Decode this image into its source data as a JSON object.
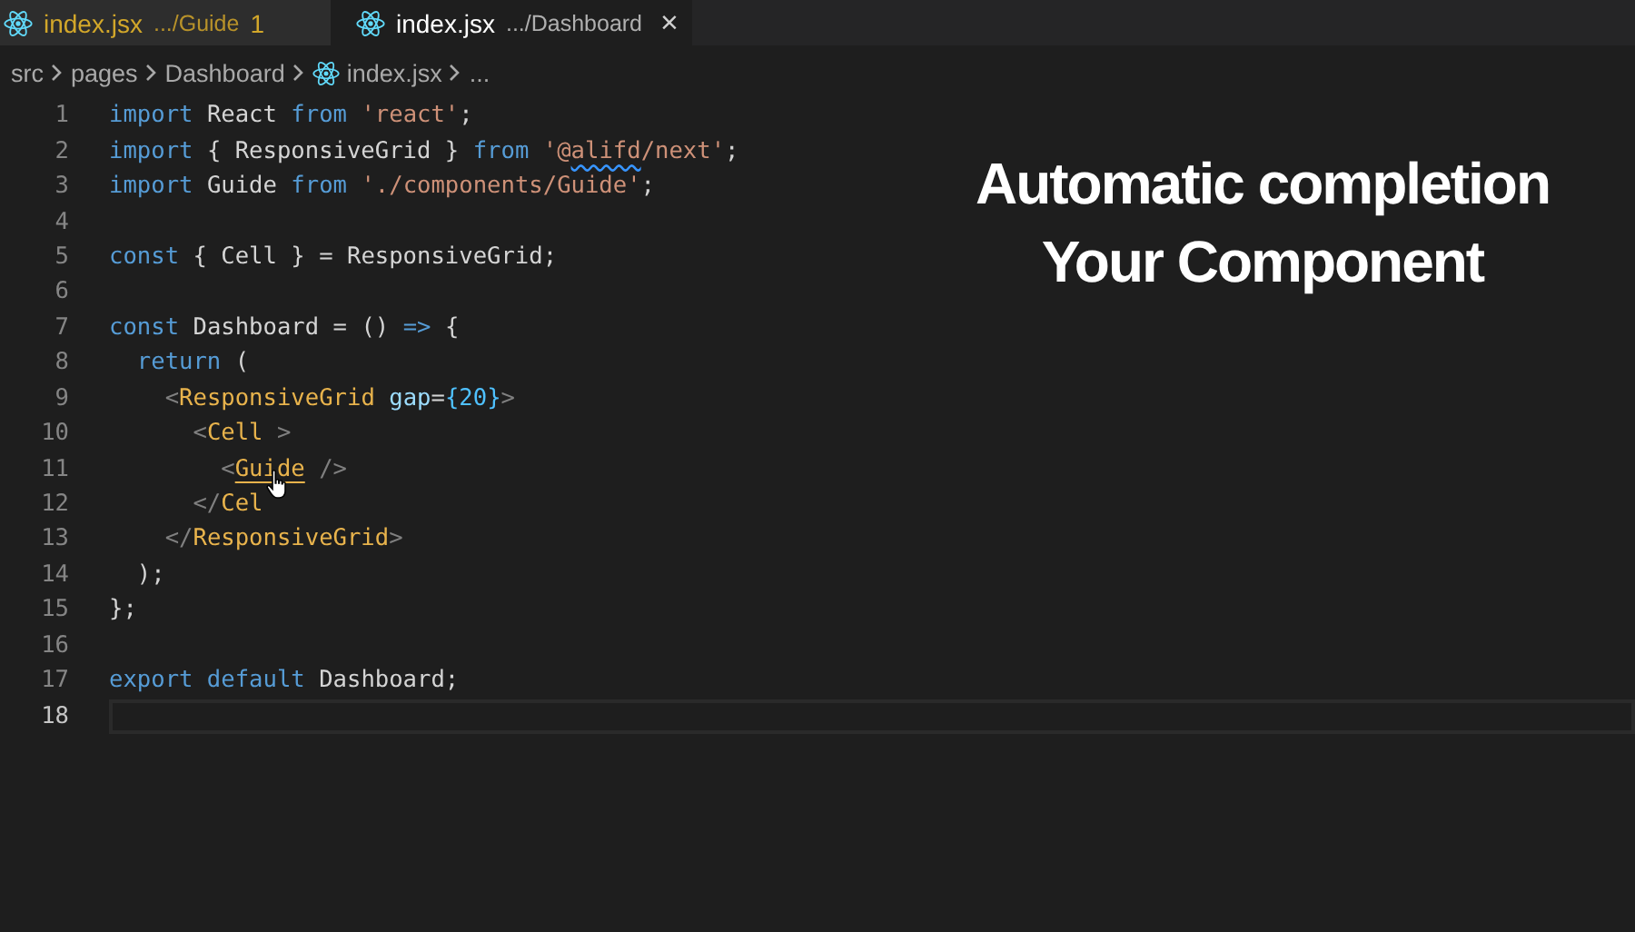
{
  "tabs": [
    {
      "name": "index.jsx",
      "path": ".../Guide",
      "badge": "1",
      "warning": true,
      "selected": false
    },
    {
      "name": "index.jsx",
      "path": ".../Dashboard",
      "close": "×",
      "warning": false,
      "selected": true
    }
  ],
  "breadcrumb": [
    {
      "label": "src",
      "kind": "folder"
    },
    {
      "label": "pages",
      "kind": "folder"
    },
    {
      "label": "Dashboard",
      "kind": "folder"
    },
    {
      "label": "index.jsx",
      "kind": "file"
    },
    {
      "label": "...",
      "kind": "more"
    }
  ],
  "lines": [
    {
      "number": "1",
      "current": false,
      "tokens": [
        {
          "t": "import",
          "kind": "kw"
        },
        {
          "t": " React ",
          "kind": "plain"
        },
        {
          "t": "from",
          "kind": "kw"
        },
        {
          "t": " 'react'",
          "kind": "str"
        },
        {
          "t": ";",
          "kind": "plain"
        }
      ]
    },
    {
      "number": "2",
      "current": false,
      "tokens": [
        {
          "t": "import",
          "kind": "kw"
        },
        {
          "t": " { ResponsiveGrid } ",
          "kind": "plain"
        },
        {
          "t": "from",
          "kind": "kw"
        },
        {
          "t": " '@",
          "kind": "str"
        },
        {
          "t": "alifd",
          "kind": "warn"
        },
        {
          "t": "/next'",
          "kind": "str"
        },
        {
          "t": ";",
          "kind": "plain"
        }
      ]
    },
    {
      "number": "3",
      "current": false,
      "tokens": [
        {
          "t": "import",
          "kind": "kw"
        },
        {
          "t": " Guide ",
          "kind": "plain"
        },
        {
          "t": "from",
          "kind": "kw"
        },
        {
          "t": " './components/Guide'",
          "kind": "str"
        },
        {
          "t": ";",
          "kind": "plain"
        }
      ]
    },
    {
      "number": "4",
      "current": false
    },
    {
      "number": "5",
      "current": false,
      "tokens": [
        {
          "t": "const",
          "kind": "kw"
        },
        {
          "t": " { Cell } = ResponsiveGrid;",
          "kind": "plain"
        }
      ]
    },
    {
      "number": "6",
      "current": false
    },
    {
      "number": "7",
      "current": false,
      "tokens": [
        {
          "t": "const",
          "kind": "kw"
        },
        {
          "t": " Dashboard = () ",
          "kind": "plain"
        },
        {
          "t": "=>",
          "kind": "kw"
        },
        {
          "t": " {",
          "kind": "plain"
        }
      ]
    },
    {
      "number": "8",
      "current": false,
      "tokens": [
        {
          "t": "  return",
          "kind": "kw"
        },
        {
          "t": " (",
          "kind": "plain"
        }
      ]
    },
    {
      "number": "9",
      "current": false,
      "tokens": [
        {
          "t": "    <",
          "kind": "punct"
        },
        {
          "t": "ResponsiveGrid",
          "kind": "tag"
        },
        {
          "t": " gap",
          "kind": "attr"
        },
        {
          "t": "=",
          "kind": "plain"
        },
        {
          "t": "{20}",
          "kind": "num"
        },
        {
          "t": ">",
          "kind": "punct"
        }
      ]
    },
    {
      "number": "10",
      "current": false,
      "tokens": [
        {
          "t": "      <",
          "kind": "punct"
        },
        {
          "t": "Cell",
          "kind": "tag"
        },
        {
          "t": " >",
          "kind": "punct"
        }
      ]
    },
    {
      "number": "11",
      "current": false,
      "tokens": [
        {
          "t": "        <",
          "kind": "punct"
        },
        {
          "t": "Guide",
          "kind": "link"
        },
        {
          "t": " />",
          "kind": "punct"
        }
      ]
    },
    {
      "number": "12",
      "current": false,
      "tokens": [
        {
          "t": "      </",
          "kind": "punct"
        },
        {
          "t": "Cel",
          "kind": "tag"
        }
      ]
    },
    {
      "number": "13",
      "current": false,
      "tokens": [
        {
          "t": "    </",
          "kind": "punct"
        },
        {
          "t": "ResponsiveGrid",
          "kind": "tag"
        },
        {
          "t": ">",
          "kind": "punct"
        }
      ]
    },
    {
      "number": "14",
      "current": false,
      "tokens": [
        {
          "t": "  );",
          "kind": "plain"
        }
      ]
    },
    {
      "number": "15",
      "current": false,
      "tokens": [
        {
          "t": "};",
          "kind": "plain"
        }
      ]
    },
    {
      "number": "16",
      "current": false
    },
    {
      "number": "17",
      "current": false,
      "tokens": [
        {
          "t": "export default",
          "kind": "kw"
        },
        {
          "t": " Dashboard;",
          "kind": "plain"
        }
      ]
    },
    {
      "number": "18",
      "current": true
    }
  ],
  "caption": [
    "Automatic completion",
    "Your Component"
  ]
}
